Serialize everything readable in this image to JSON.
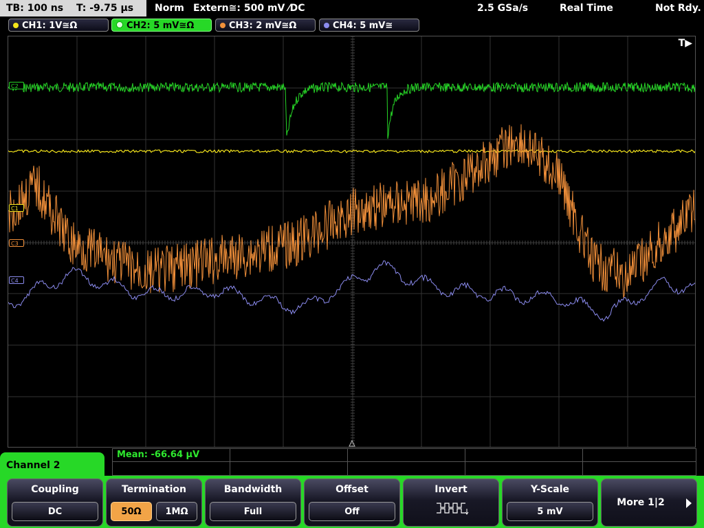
{
  "status": {
    "timebase": "TB: 100 ns",
    "trigger_time": "T: -9.75 µs",
    "mode": "Norm",
    "trigger": "Extern≅: 500 mV ⁄DC",
    "sample_rate": "2.5 GSa/s",
    "acq_mode": "Real Time",
    "state": "Not Rdy."
  },
  "channels": [
    {
      "label": "CH1: 1V≅Ω",
      "color": "#f4e41c"
    },
    {
      "label": "CH2: 5 mV≅Ω",
      "color": "#27d827"
    },
    {
      "label": "CH3: 2 mV≅Ω",
      "color": "#f2903a"
    },
    {
      "label": "CH4: 5 mV≅",
      "color": "#8c8cf0"
    }
  ],
  "screen": {
    "trigger_marker": "T▶",
    "markers": [
      {
        "label": "C2",
        "color": "#27d827"
      },
      {
        "label": "C1",
        "color": "#f4e41c"
      },
      {
        "label": "C3",
        "color": "#f2903a"
      },
      {
        "label": "C4",
        "color": "#8c8cf0"
      }
    ]
  },
  "measurement": {
    "mean": "Mean: -66.64 µV"
  },
  "menu": {
    "title": "Channel 2",
    "coupling": {
      "label": "Coupling",
      "value": "DC"
    },
    "termination": {
      "label": "Termination",
      "opt1": "50Ω",
      "opt2": "1MΩ"
    },
    "bandwidth": {
      "label": "Bandwidth",
      "value": "Full"
    },
    "offset": {
      "label": "Offset",
      "value": "Off"
    },
    "invert": {
      "label": "Invert",
      "icon": "invert-waveform-icon"
    },
    "yscale": {
      "label": "Y-Scale",
      "value": "5 mV"
    },
    "more": {
      "label": "More 1|2",
      "icon": "arrow-right-icon"
    }
  }
}
